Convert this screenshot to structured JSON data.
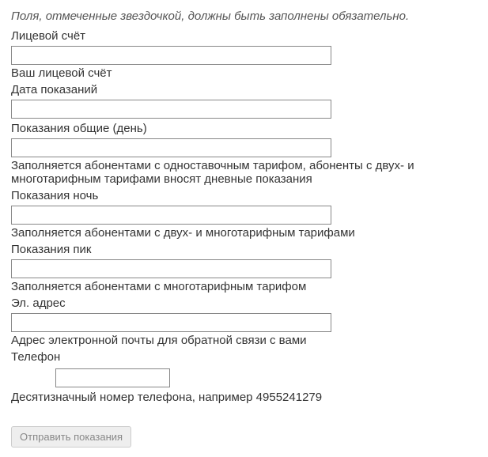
{
  "instruction": "Поля, отмеченные звездочкой, должны быть заполнены обязательно.",
  "fields": {
    "account": {
      "label": "Лицевой счёт",
      "help": "Ваш лицевой счёт"
    },
    "date": {
      "label": "Дата показаний"
    },
    "day": {
      "label": "Показания общие (день)",
      "help": "Заполняется абонентами с одноставочным тарифом, абоненты с двух- и многотарифным тарифами вносят дневные показания"
    },
    "night": {
      "label": "Показания ночь",
      "help": "Заполняется абонентами с двух- и многотарифным тарифами"
    },
    "peak": {
      "label": "Показания пик",
      "help": "Заполняется абонентами с многотарифным тарифом"
    },
    "email": {
      "label": "Эл. адрес",
      "help": "Адрес электронной почты для обратной связи с вами"
    },
    "phone": {
      "label": "Телефон",
      "help": "Десятизначный номер телефона, например 4955241279"
    }
  },
  "submit": {
    "label": "Отправить показания"
  }
}
